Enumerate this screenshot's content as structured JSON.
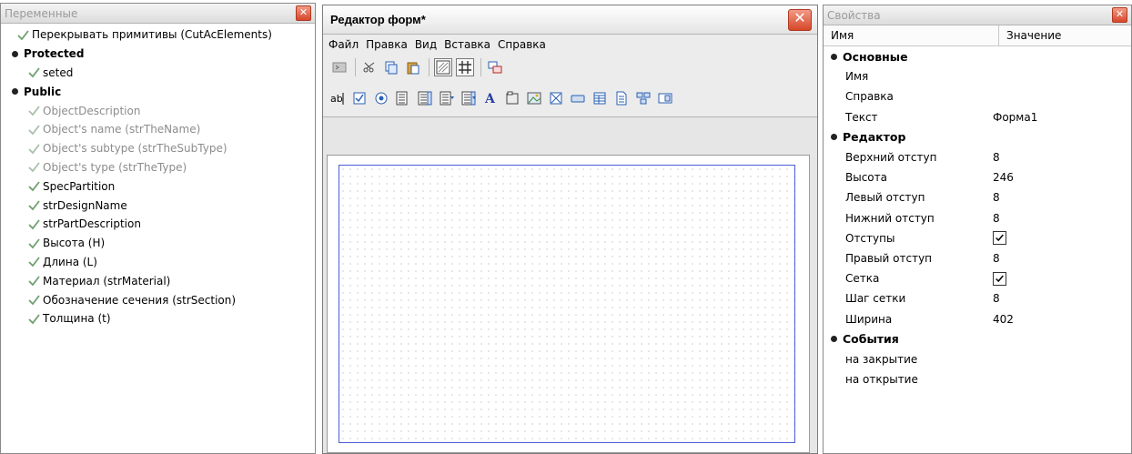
{
  "variables": {
    "title": "Переменные",
    "items": [
      {
        "label": "Перекрывать примитивы (CutAcElements)",
        "kind": "item",
        "level": 0,
        "muted": false
      },
      {
        "label": "Protected",
        "kind": "group"
      },
      {
        "label": "seted",
        "kind": "item",
        "level": 1,
        "muted": false
      },
      {
        "label": "Public",
        "kind": "group"
      },
      {
        "label": "ObjectDescription",
        "kind": "item",
        "level": 1,
        "muted": true
      },
      {
        "label": "Object's name (strTheName)",
        "kind": "item",
        "level": 1,
        "muted": true
      },
      {
        "label": "Object's subtype (strTheSubType)",
        "kind": "item",
        "level": 1,
        "muted": true
      },
      {
        "label": "Object's type (strTheType)",
        "kind": "item",
        "level": 1,
        "muted": true
      },
      {
        "label": "SpecPartition",
        "kind": "item",
        "level": 1,
        "muted": false
      },
      {
        "label": "strDesignName",
        "kind": "item",
        "level": 1,
        "muted": false
      },
      {
        "label": "strPartDescription",
        "kind": "item",
        "level": 1,
        "muted": false
      },
      {
        "label": "Высота (H)",
        "kind": "item",
        "level": 1,
        "muted": false
      },
      {
        "label": "Длина (L)",
        "kind": "item",
        "level": 1,
        "muted": false
      },
      {
        "label": "Материал (strMaterial)",
        "kind": "item",
        "level": 1,
        "muted": false
      },
      {
        "label": "Обозначение сечения (strSection)",
        "kind": "item",
        "level": 1,
        "muted": false
      },
      {
        "label": "Толщина (t)",
        "kind": "item",
        "level": 1,
        "muted": false
      }
    ]
  },
  "editor": {
    "title": "Редактор форм*",
    "menu": [
      "Файл",
      "Правка",
      "Вид",
      "Вставка",
      "Справка"
    ],
    "toolbar1": [
      "run-icon",
      "cut-icon",
      "copy-icon",
      "paste-icon",
      "show-form-icon",
      "grid-icon",
      "tab-order-icon"
    ],
    "toolbar2": [
      "text-box-icon",
      "checkbox-icon",
      "radio-icon",
      "list-box-icon",
      "list-edit-icon",
      "combo-box-icon",
      "combo-edit-icon",
      "label-icon",
      "frame-icon",
      "image-icon",
      "placeholder-icon",
      "button-icon",
      "table-icon",
      "page-icon",
      "tree-icon",
      "edit-button-icon"
    ]
  },
  "properties": {
    "title": "Свойства",
    "col_name": "Имя",
    "col_value": "Значение",
    "groups": [
      {
        "name": "Основные",
        "rows": [
          {
            "key": "Имя",
            "value": ""
          },
          {
            "key": "Справка",
            "value": ""
          },
          {
            "key": "Текст",
            "value": "Форма1"
          }
        ]
      },
      {
        "name": "Редактор",
        "rows": [
          {
            "key": "Верхний отступ",
            "value": "8"
          },
          {
            "key": "Высота",
            "value": "246"
          },
          {
            "key": "Левый отступ",
            "value": "8"
          },
          {
            "key": "Нижний отступ",
            "value": "8"
          },
          {
            "key": "Отступы",
            "value": "",
            "checked": true
          },
          {
            "key": "Правый отступ",
            "value": "8"
          },
          {
            "key": "Сетка",
            "value": "",
            "checked": true
          },
          {
            "key": "Шаг сетки",
            "value": "8"
          },
          {
            "key": "Ширина",
            "value": "402"
          }
        ]
      },
      {
        "name": "События",
        "rows": [
          {
            "key": "на закрытие",
            "value": ""
          },
          {
            "key": "на открытие",
            "value": ""
          }
        ]
      }
    ]
  }
}
